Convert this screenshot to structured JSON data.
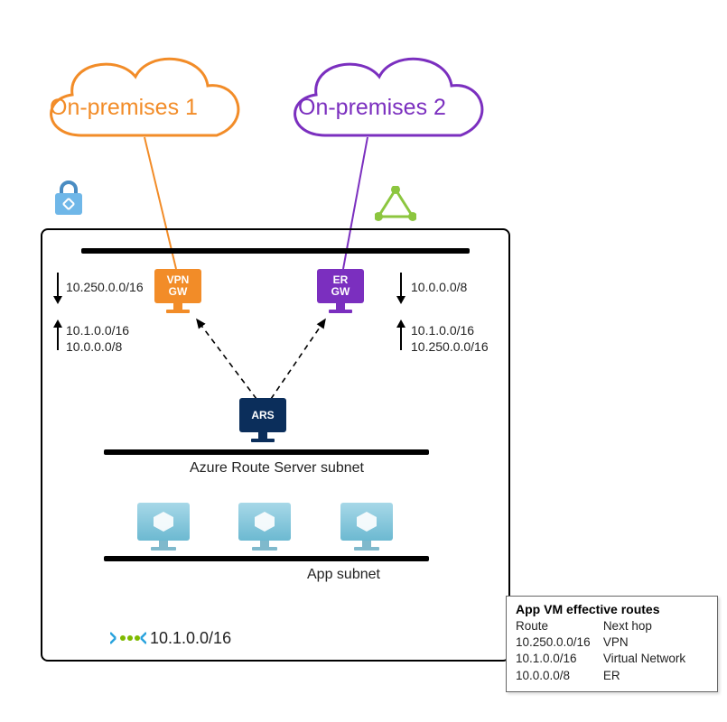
{
  "clouds": {
    "onprem1": {
      "label": "On-premises 1",
      "color": "#f28c28"
    },
    "onprem2": {
      "label": "On-premises 2",
      "color": "#7b2fbf"
    }
  },
  "gateways": {
    "vpn": {
      "label": "VPN\nGW"
    },
    "er": {
      "label": "ER\nGW"
    },
    "ars": {
      "label": "ARS"
    }
  },
  "routes": {
    "left_in": "10.250.0.0/16",
    "left_out1": "10.1.0.0/16",
    "left_out2": "10.0.0.0/8",
    "right_in": "10.0.0.0/8",
    "right_out1": "10.1.0.0/16",
    "right_out2": "10.250.0.0/16"
  },
  "subnets": {
    "ars": "Azure Route Server subnet",
    "app": "App subnet"
  },
  "vnet_cidr": "10.1.0.0/16",
  "route_table": {
    "title": "App VM effective routes",
    "header": {
      "c1": "Route",
      "c2": "Next hop"
    },
    "rows": [
      {
        "c1": "10.250.0.0/16",
        "c2": "VPN"
      },
      {
        "c1": "10.1.0.0/16",
        "c2": "Virtual Network"
      },
      {
        "c1": "10.0.0.0/8",
        "c2": "ER"
      }
    ]
  }
}
